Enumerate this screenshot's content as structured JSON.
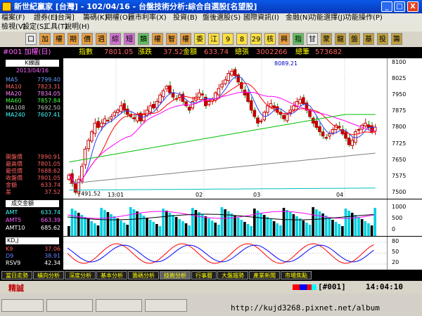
{
  "window": {
    "title": "新世紀贏家 [台灣] - 102/04/16 - 台盤技術分析:綜合自選股[名望股]",
    "min_label": "_",
    "max_label": "□",
    "close_label": "X"
  },
  "menu": {
    "row1": [
      "檔案(F)",
      "證券(E)",
      "[台灣]",
      "籌碼(K)",
      "期權(O)",
      "匯市利率(X)",
      "投資(B)",
      "盤後選股(S)",
      "國際資訊(I)",
      "金融(N)",
      "功能選擇(J)",
      "功能操作(P)"
    ],
    "row2": [
      "檢視(V)",
      "設定(S)",
      "工具(T)",
      "說明(H)"
    ]
  },
  "toolbar": {
    "buttons": [
      "口",
      "加",
      "權",
      "期",
      "價",
      "週",
      "綜",
      "短",
      "類",
      "權",
      "智",
      "權",
      "委",
      "江",
      "9",
      "8",
      "29",
      "核",
      "興",
      "指",
      "甘",
      "蒙",
      "龍",
      "盤",
      "基",
      "投",
      "籌"
    ]
  },
  "info": {
    "symbol": "#001 加權(日)",
    "index_label": "指數",
    "index_value": "7801.05",
    "change_label": "漲跌",
    "change_value": "37.52",
    "amount_label": "金額",
    "amount_value": "633.74",
    "vol_label": "總張",
    "vol_value": "3002266",
    "trades_label": "總筆",
    "trades_value": "573682"
  },
  "sidebar": {
    "header": "K線圖",
    "date": "2013/04/16",
    "mas": [
      {
        "label": "MA5",
        "value": "7799.40",
        "color": "#60a0ff"
      },
      {
        "label": "MA10",
        "value": "7823.31",
        "color": "#ff6060"
      },
      {
        "label": "MA20",
        "value": "7834.05",
        "color": "#ff80ff"
      },
      {
        "label": "MA60",
        "value": "7857.84",
        "color": "#40ff40"
      },
      {
        "label": "MA108",
        "value": "7692.50",
        "color": "#c0c0c0"
      },
      {
        "label": "MA240",
        "value": "7607.41",
        "color": "#40ffff"
      }
    ],
    "prices": [
      {
        "label": "開盤價",
        "value": "7890.91",
        "color": "#ff6060"
      },
      {
        "label": "最高價",
        "value": "7801.05",
        "color": "#ff6060"
      },
      {
        "label": "最低價",
        "value": "7688.62",
        "color": "#ff6060"
      },
      {
        "label": "收盤價",
        "value": "7801.05",
        "color": "#ff6060"
      },
      {
        "label": "金額",
        "value": "633.74",
        "color": "#ff6060"
      },
      {
        "label": "差",
        "value": "37.52",
        "color": "#ff6060"
      }
    ]
  },
  "chart_data": {
    "type": "candlestick",
    "date_labels": [
      "13:01",
      "02",
      "03",
      "04"
    ],
    "yticks": [
      "8100",
      "8025",
      "7950",
      "7875",
      "7800",
      "7725",
      "7650",
      "7575",
      "7500"
    ],
    "ylim": [
      7470,
      8120
    ],
    "annotations": [
      "8089.21",
      "7491.52"
    ],
    "series": [
      {
        "name": "MA5",
        "color": "#2040ff"
      },
      {
        "name": "MA10",
        "color": "#ff0000"
      },
      {
        "name": "MA20",
        "color": "#ff00ff"
      },
      {
        "name": "MA60",
        "color": "#00c000"
      },
      {
        "name": "MA108",
        "color": "#808080"
      },
      {
        "name": "MA240",
        "color": "#00c0c0"
      }
    ]
  },
  "volume": {
    "header": "成交金額",
    "items": [
      {
        "label": "AMT",
        "value": "633.74",
        "color": "#40ffff"
      },
      {
        "label": "AMT5",
        "value": "663.39",
        "color": "#ff60ff"
      },
      {
        "label": "AMT10",
        "value": "685.62",
        "color": "#ffffff"
      }
    ],
    "yticks": [
      "1000",
      "500",
      "0"
    ]
  },
  "kd": {
    "header": "KD,J",
    "items": [
      {
        "label": "K9",
        "value": "37.06",
        "color": "#ff6060"
      },
      {
        "label": "D9",
        "value": "38.91",
        "color": "#6080ff"
      },
      {
        "label": "RSV9",
        "value": "42.34",
        "color": "#ffffff"
      }
    ],
    "yticks": [
      "80",
      "50",
      "20"
    ]
  },
  "tabs": [
    "當日走勢",
    "橫向分析",
    "深度分析",
    "基本分析",
    "籌碼分析",
    "技術分析",
    "行事曆",
    "大盤趨勢",
    "產業新聞",
    "市場焦點"
  ],
  "status": {
    "left": "精誠",
    "symbol": "#001",
    "time": "14:04:10",
    "url": "http://kujd3268.pixnet.net/album"
  }
}
